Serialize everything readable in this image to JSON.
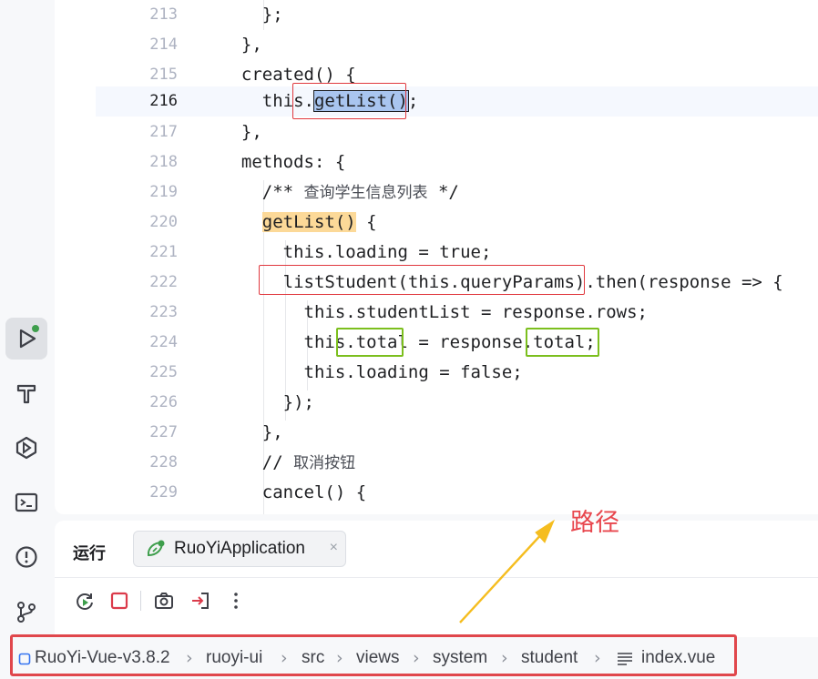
{
  "editor": {
    "lines": [
      {
        "num": "213",
        "code": "    };"
      },
      {
        "num": "214",
        "code": "  },"
      },
      {
        "num": "215",
        "code": "  created() {"
      },
      {
        "num": "216",
        "code_pre": "    this.",
        "code_sel": "getList()",
        "code_post": ";"
      },
      {
        "num": "217",
        "code": "  },"
      },
      {
        "num": "218",
        "code": "  methods: {"
      },
      {
        "num": "219",
        "code_pre": "    /** ",
        "comment": "查询学生信息列表",
        "code_post": " */"
      },
      {
        "num": "220",
        "code_pre": "    ",
        "code_hl": "getList()",
        "code_post": " {"
      },
      {
        "num": "221",
        "code": "      this.loading = true;"
      },
      {
        "num": "222",
        "code": "      listStudent(this.queryParams).then(response => {"
      },
      {
        "num": "223",
        "code": "        this.studentList = response.rows;"
      },
      {
        "num": "224",
        "code": "        this.total = response.total;"
      },
      {
        "num": "225",
        "code": "        this.loading = false;"
      },
      {
        "num": "226",
        "code": "      });"
      },
      {
        "num": "227",
        "code": "    },"
      },
      {
        "num": "228",
        "code_pre": "    // ",
        "comment": "取消按钮",
        "code_post": ""
      },
      {
        "num": "229",
        "code": "    cancel() {"
      }
    ]
  },
  "run_panel": {
    "title": "运行",
    "tab_label": "RuoYiApplication",
    "tab_close": "×"
  },
  "breadcrumb": {
    "items": [
      "RuoYi-Vue-v3.8.2",
      "ruoyi-ui",
      "src",
      "views",
      "system",
      "student",
      "index.vue"
    ],
    "separator": "›"
  },
  "annotation": {
    "label": "路径"
  },
  "colors": {
    "accent_red": "#e0383e",
    "accent_green": "#7cbf1e",
    "annotation_arrow": "#f5bd1f"
  }
}
